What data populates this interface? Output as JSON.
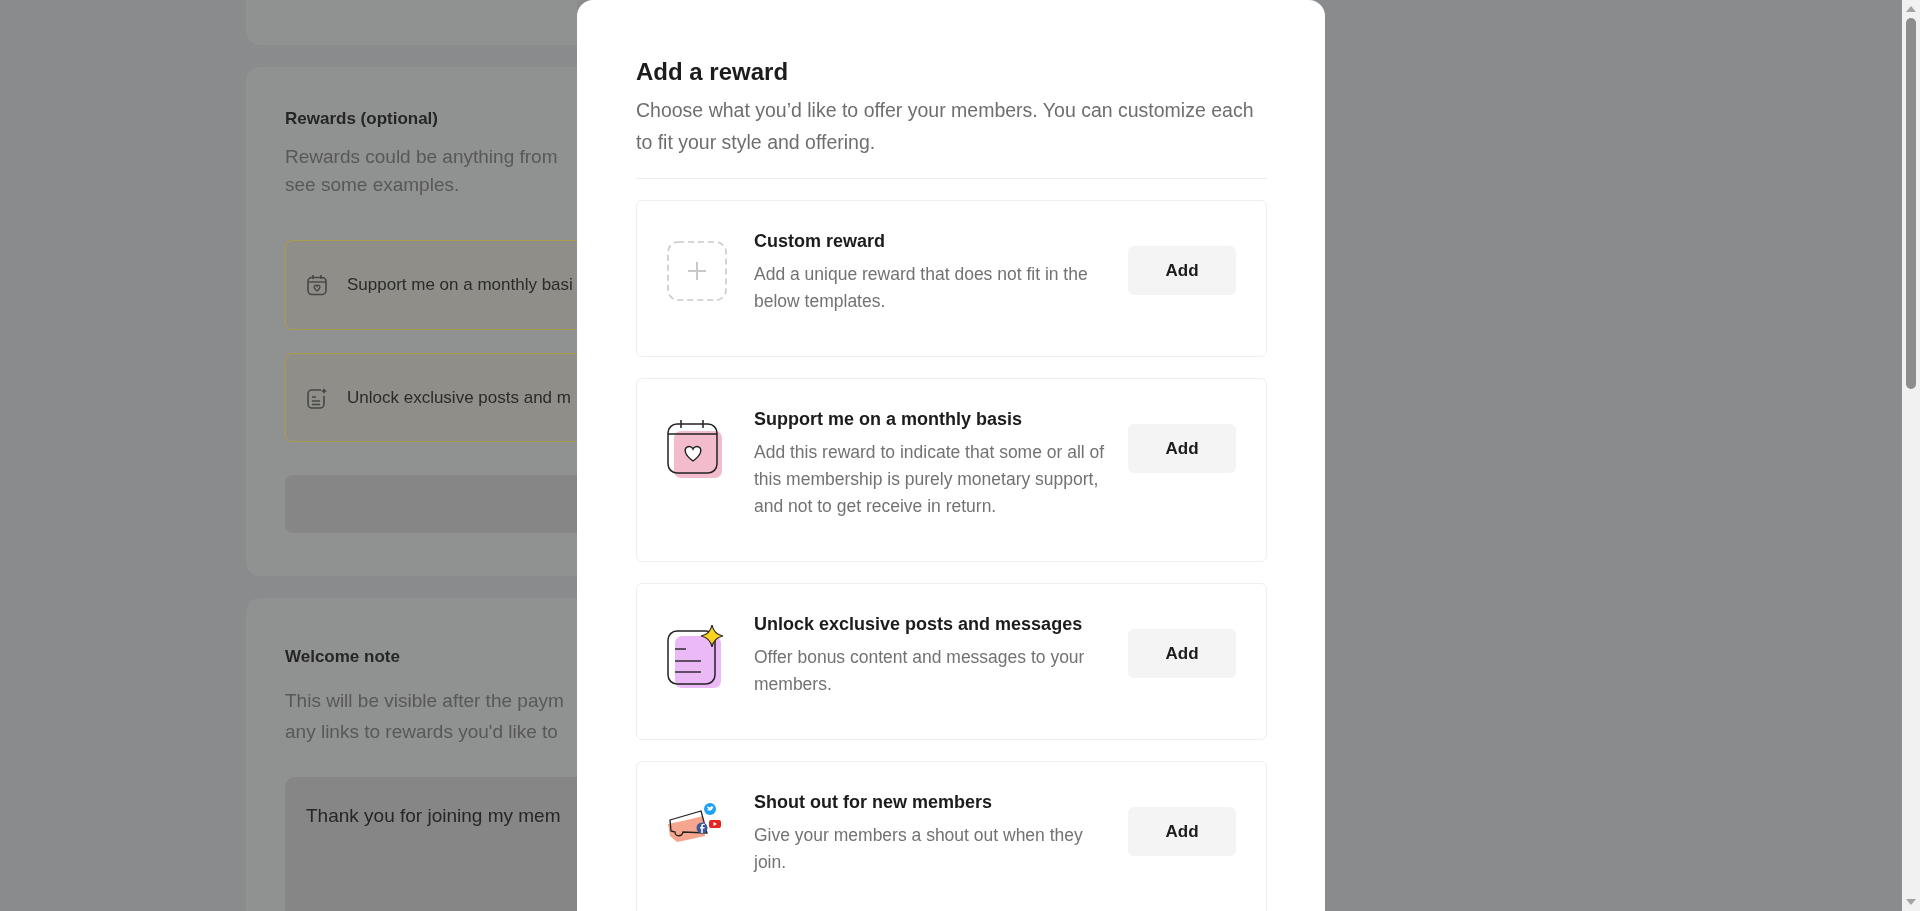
{
  "background_page": {
    "rewards_section": {
      "heading": "Rewards (optional)",
      "description_lines": [
        "Rewards could be anything from",
        "see some examples."
      ],
      "rewards": [
        {
          "label": "Support me on a monthly basi"
        },
        {
          "label": "Unlock exclusive posts and m"
        }
      ]
    },
    "welcome_section": {
      "heading": "Welcome note",
      "description_lines": [
        "This will be visible after the paym",
        "any links to rewards you'd like to"
      ],
      "message": {
        "value": "Thank you for joining my mem"
      }
    }
  },
  "modal": {
    "title": "Add a reward",
    "description": "Choose what you’d like to offer your members. You can customize each to fit your style and offering.",
    "rewards": [
      {
        "title": "Custom reward",
        "description": "Add a unique reward that does not fit in the below templates.",
        "button": "Add"
      },
      {
        "title": "Support me on a monthly basis",
        "description": "Add this reward to indicate that some or all of this membership is purely monetary support, and not to get receive in return.",
        "button": "Add"
      },
      {
        "title": "Unlock exclusive posts and messages",
        "description": "Offer bonus content and messages to your members.",
        "button": "Add"
      },
      {
        "title": "Shout out for new members",
        "description": "Give your members a shout out when they join.",
        "button": "Add"
      }
    ]
  }
}
